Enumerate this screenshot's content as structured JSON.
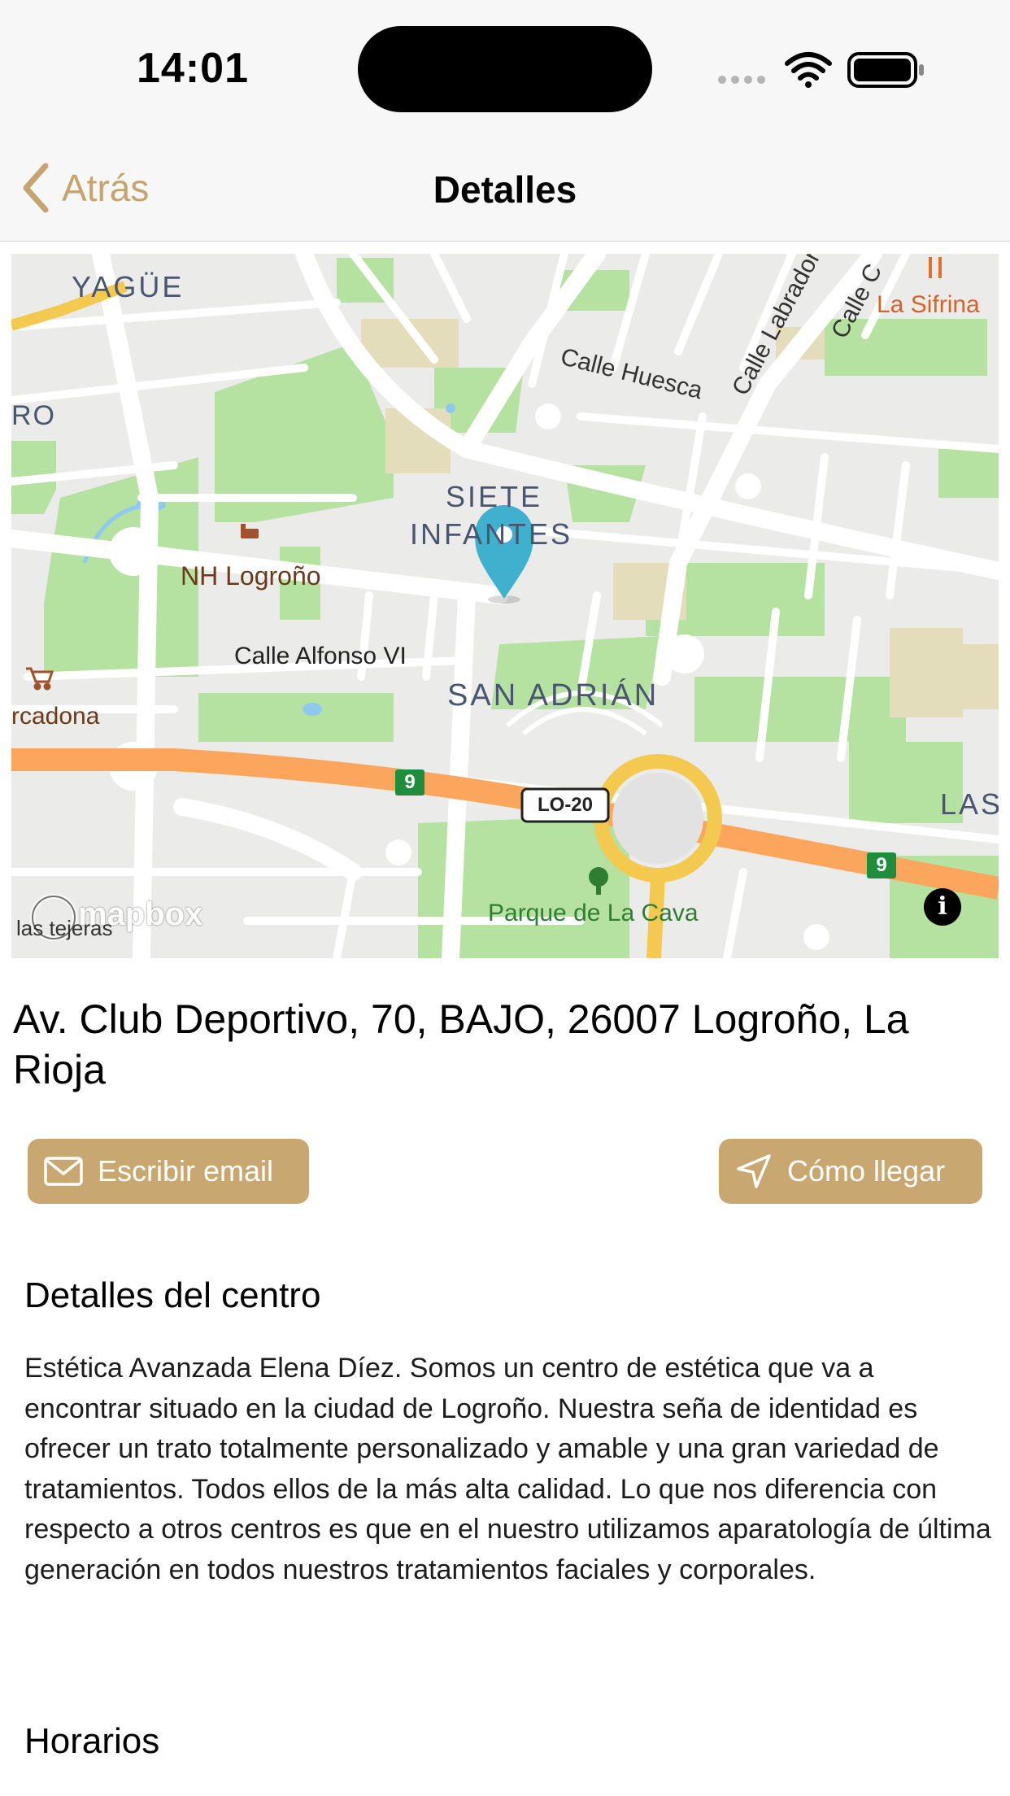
{
  "status_bar": {
    "time": "14:01"
  },
  "nav": {
    "back_label": "Atrás",
    "title": "Detalles"
  },
  "map": {
    "labels": {
      "yague": "YAGÜE",
      "ro": "RO",
      "calle_huesca": "Calle Huesca",
      "calle_labrador": "Calle Labrador",
      "calle_c": "Calle C",
      "la_sifrina": "La Sifrina",
      "siete_infantes_1": "SIETE",
      "siete_infantes_2": "INFANTES",
      "nh_logrono": "NH Logroño",
      "calle_alfonso": "Calle Alfonso VI",
      "san_adrian": "SAN ADRIÁN",
      "rcadona": "rcadona",
      "lo20": "LO-20",
      "road9": "9",
      "las": "LAS",
      "parque": "Parque de La Cava",
      "lastejeras": "las tejeras",
      "mapbox": "mapbox"
    }
  },
  "address": "Av. Club Deportivo, 70, BAJO, 26007 Logroño, La Rioja",
  "actions": {
    "email_label": "Escribir email",
    "route_label": "Cómo llegar"
  },
  "details": {
    "title": "Detalles del centro",
    "text": "Estética Avanzada Elena Díez. Somos un centro de estética que va a encontrar situado en la ciudad de Logroño. Nuestra seña de identidad es ofrecer un trato totalmente personalizado y amable y una gran variedad de tratamientos. Todos ellos de la más alta calidad.  Lo que nos diferencia con respecto a otros centros es que en el nuestro utilizamos aparatología de última generación en todos nuestros tratamientos faciales y corporales."
  },
  "hours": {
    "title": "Horarios"
  },
  "colors": {
    "accent": "#c8a870",
    "pin": "#3fb1ce",
    "park": "#b6e2a1",
    "highway": "#fca65d",
    "ring": "#f3c950"
  }
}
